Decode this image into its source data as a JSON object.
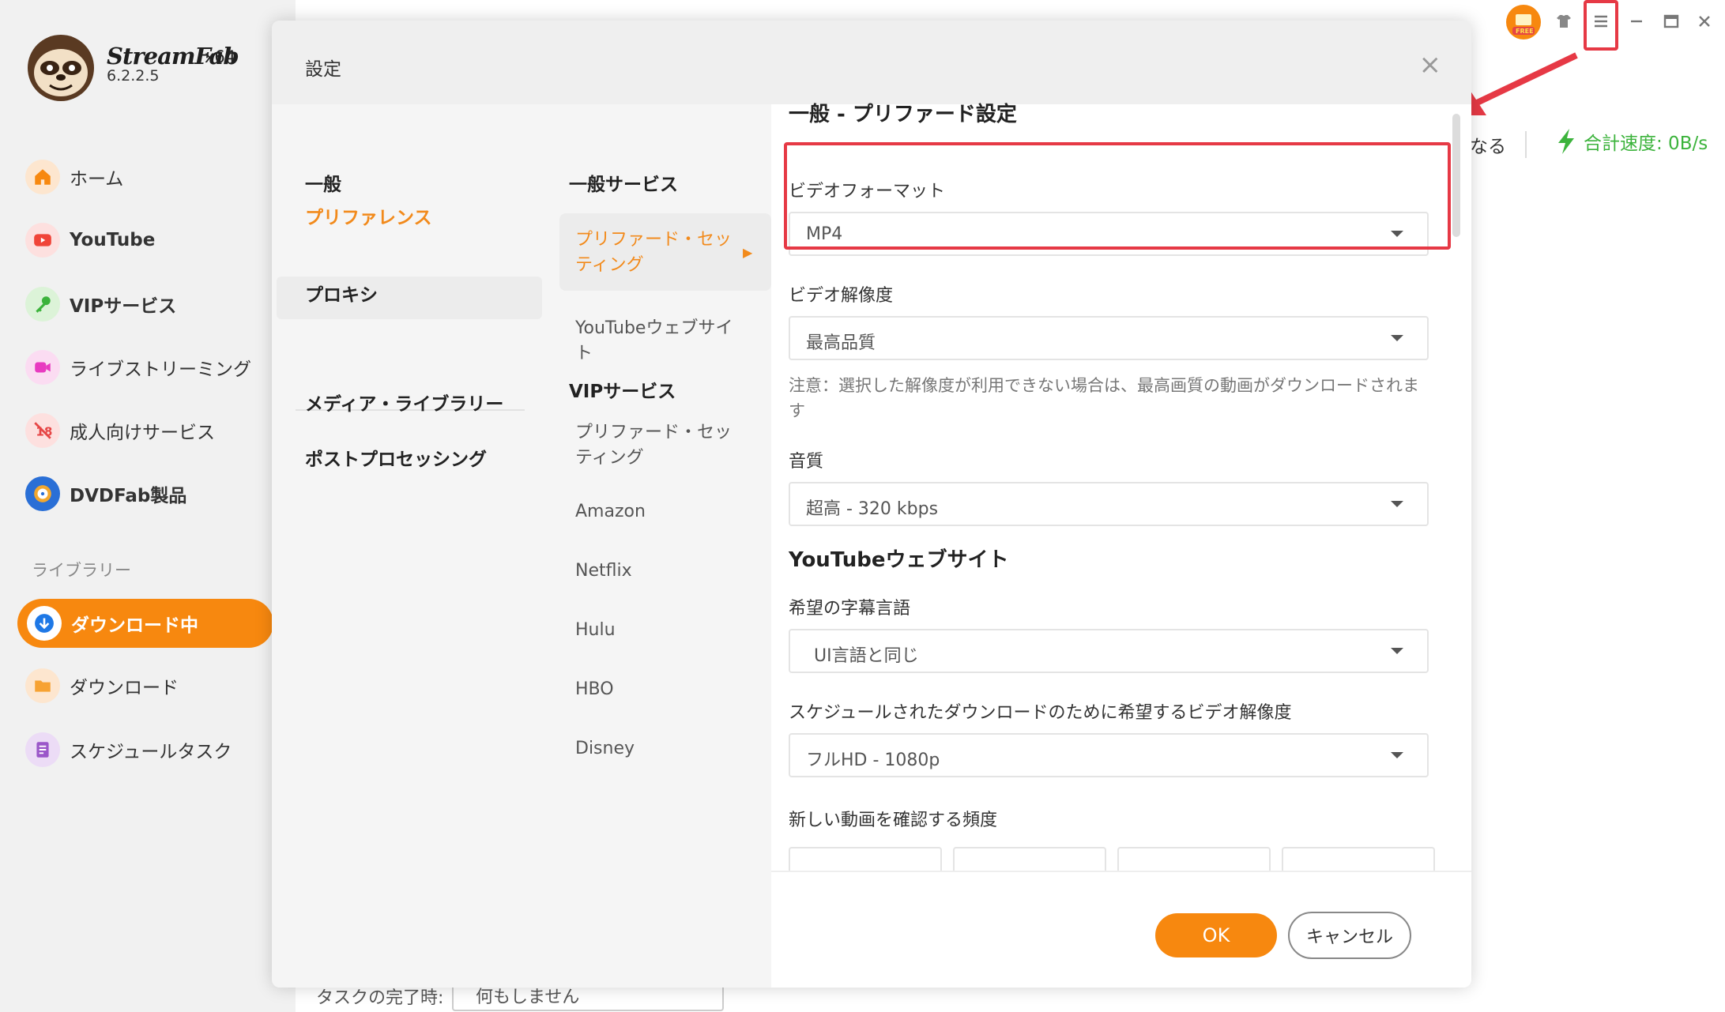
{
  "app": {
    "brand": "StreamFab",
    "arch": "x64",
    "version": "6.2.2.5"
  },
  "sidebar": {
    "items": [
      {
        "label": "ホーム",
        "icon": "home-icon"
      },
      {
        "label": "YouTube",
        "icon": "youtube-icon"
      },
      {
        "label": "VIPサービス",
        "icon": "key-icon"
      },
      {
        "label": "ライブストリーミング",
        "icon": "camera-icon"
      },
      {
        "label": "成人向けサービス",
        "icon": "adult-icon"
      },
      {
        "label": "DVDFab製品",
        "icon": "dvdfab-icon"
      }
    ],
    "library_label": "ライブラリー",
    "library_items": [
      {
        "label": "ダウンロード中",
        "icon": "download-icon",
        "active": true
      },
      {
        "label": "ダウンロード",
        "icon": "folder-icon"
      },
      {
        "label": "スケジュールタスク",
        "icon": "task-icon"
      }
    ]
  },
  "status": {
    "partial_text": "なる",
    "speed": "合計速度: 0B/s"
  },
  "bottom": {
    "label": "タスクの完了時:",
    "select_value": "何もしません"
  },
  "dialog": {
    "title": "設定",
    "col1": {
      "items": [
        "一般",
        "プリファレンス",
        "プロキシ",
        "メディア・ライブラリー",
        "ポストプロセッシング"
      ]
    },
    "col2": {
      "general_head": "一般サービス",
      "general_active": "プリファード・セッティング",
      "general_item": "YouTubeウェブサイト",
      "vip_head": "VIPサービス",
      "vip_items": [
        "プリファード・セッティング",
        "Amazon",
        "Netflix",
        "Hulu",
        "HBO",
        "Disney"
      ]
    },
    "content": {
      "title": "一般 - プリファード設定",
      "video_format_label": "ビデオフォーマット",
      "video_format_value": "MP4",
      "resolution_label": "ビデオ解像度",
      "resolution_value": "最高品質",
      "note": "注意：選択した解像度が利用できない場合は、最高画質の動画がダウンロードされます",
      "audio_label": "音質",
      "audio_value": "超高 - 320 kbps",
      "youtube_head": "YouTubeウェブサイト",
      "subtitle_label": "希望の字幕言語",
      "subtitle_value": "UI言語と同じ",
      "schedule_label": "スケジュールされたダウンロードのために希望するビデオ解像度",
      "schedule_value": "フルHD - 1080p",
      "frequency_label": "新しい動画を確認する頻度"
    },
    "ok": "OK",
    "cancel": "キャンセル"
  },
  "colors": {
    "accent": "#f7880f",
    "highlight": "#e63945",
    "speed": "#3cb33c"
  }
}
